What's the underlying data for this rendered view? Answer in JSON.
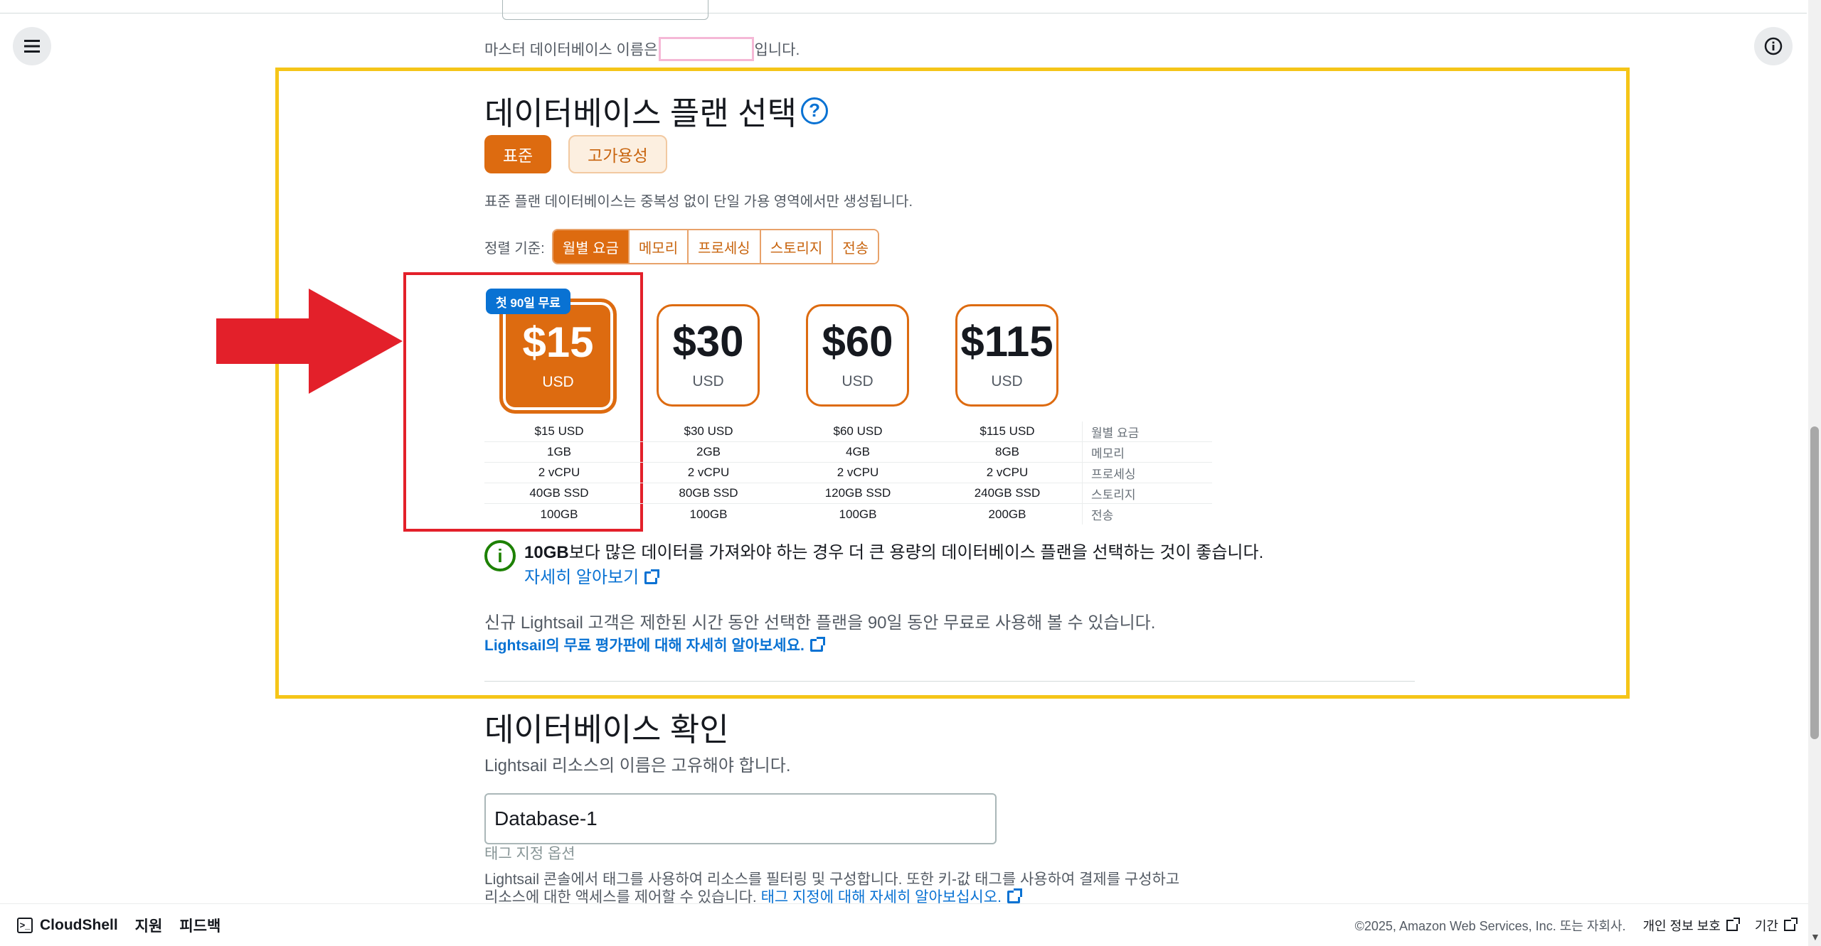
{
  "master_note": {
    "prefix": "마스터 데이터베이스 이름은",
    "suffix": "입니다."
  },
  "plan_section": {
    "title": "데이터베이스 플랜 선택",
    "help_symbol": "?",
    "toggle_standard": "표준",
    "toggle_ha": "고가용성",
    "description": "표준 플랜 데이터베이스는 중복성 없이 단일 가용 영역에서만 생성됩니다.",
    "sort_label": "정렬 기준:",
    "sort_options": [
      "월별 요금",
      "메모리",
      "프로세싱",
      "스토리지",
      "전송"
    ],
    "free_badge": "첫 90일 무료",
    "plans": [
      {
        "amount": "$15",
        "currency": "USD",
        "monthly": "$15 USD",
        "memory": "1GB",
        "processing": "2 vCPU",
        "storage": "40GB SSD",
        "transfer": "100GB",
        "selected": true
      },
      {
        "amount": "$30",
        "currency": "USD",
        "monthly": "$30 USD",
        "memory": "2GB",
        "processing": "2 vCPU",
        "storage": "80GB SSD",
        "transfer": "100GB",
        "selected": false
      },
      {
        "amount": "$60",
        "currency": "USD",
        "monthly": "$60 USD",
        "memory": "4GB",
        "processing": "2 vCPU",
        "storage": "120GB SSD",
        "transfer": "100GB",
        "selected": false
      },
      {
        "amount": "$115",
        "currency": "USD",
        "monthly": "$115 USD",
        "memory": "8GB",
        "processing": "2 vCPU",
        "storage": "240GB SSD",
        "transfer": "200GB",
        "selected": false
      }
    ],
    "row_labels": [
      "월별 요금",
      "메모리",
      "프로세싱",
      "스토리지",
      "전송"
    ],
    "alert_bold": "10GB",
    "alert_text": "보다 많은 데이터를 가져와야 하는 경우 더 큰 용량의 데이터베이스 플랜을 선택하는 것이 좋습니다.",
    "alert_link": "자세히 알아보기",
    "free_note": "신규 Lightsail 고객은 제한된 시간 동안 선택한 플랜을 90일 동안 무료로 사용해 볼 수 있습니다.",
    "free_link": "Lightsail의 무료 평가판에 대해 자세히 알아보세요."
  },
  "confirm_section": {
    "title": "데이터베이스 확인",
    "description": "Lightsail 리소스의 이름은 고유해야 합니다.",
    "name_value": "Database-1",
    "tag_label": "태그 지정 옵션",
    "tag_desc": "Lightsail 콘솔에서 태그를 사용하여 리소스를 필터링 및 구성합니다. 또한 키-값 태그를 사용하여 결제를 구성하고 리소스에 대한 액세스를 제어할 수 있습니다.",
    "tag_link": "태그 지정에 대해 자세히 알아보십시오."
  },
  "footer": {
    "cloudshell": "CloudShell",
    "support": "지원",
    "feedback": "피드백",
    "copyright": "©2025, Amazon Web Services, Inc. 또는 자회사.",
    "privacy": "개인 정보 보호",
    "terms": "기간"
  },
  "colors": {
    "accent": "#dd6b10",
    "link": "#0972d3",
    "highlight_yellow": "#f5c518",
    "highlight_red": "#e3202a",
    "success": "#1d8102"
  },
  "icons": [
    "menu-icon",
    "info-icon",
    "help-icon",
    "arrow-icon",
    "external-link-icon",
    "terminal-icon"
  ]
}
